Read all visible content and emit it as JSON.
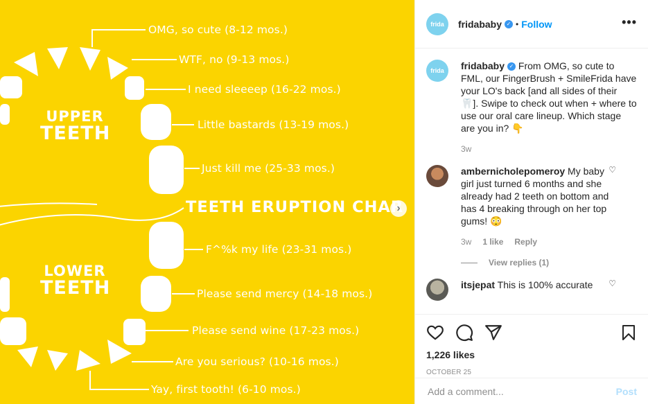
{
  "colors": {
    "media_bg": "#fbd400",
    "accent": "#0095f6",
    "avatar_bg": "#7ed2ee"
  },
  "chart": {
    "upper_small": "UPPER",
    "upper_large": "TEETH",
    "lower_small": "LOWER",
    "lower_large": "TEETH",
    "title": "TEETH ERUPTION CHAR",
    "labels": [
      "OMG, so cute (8-12 mos.)",
      "WTF, no (9-13 mos.)",
      "I need sleeeep (16-22 mos.)",
      "Little bastards (13-19 mos.)",
      "Just kill me (25-33 mos.)",
      "F^%k my life (23-31 mos.)",
      "Please send mercy (14-18 mos.)",
      "Please send wine (17-23 mos.)",
      "Are you serious? (10-16 mos.)",
      "Yay, first tooth! (6-10 mos.)"
    ]
  },
  "header": {
    "avatar_text": "frida",
    "username": "fridababy",
    "separator": "•",
    "follow": "Follow",
    "more_icon": "more-icon"
  },
  "caption": {
    "username": "fridababy",
    "text": "From OMG, so cute to FML, our FingerBrush + SmileFrida have your LO's back [and all sides of their 🦷]. Swipe to check out when + where to use our oral care lineup. Which stage are you in? 👇",
    "time": "3w"
  },
  "comments": [
    {
      "username": "ambernicholepomeroy",
      "text": "My baby girl just turned 6 months and she already had 2 teeth on bottom and has 4 breaking through on her top gums! 😳",
      "time": "3w",
      "likes": "1 like",
      "reply": "Reply",
      "view_replies": "View replies (1)"
    },
    {
      "username": "itsjepat",
      "text": "This is 100% accurate"
    }
  ],
  "likes": "1,226 likes",
  "date": "OCTOBER 25",
  "add_comment": {
    "placeholder": "Add a comment...",
    "post": "Post"
  }
}
